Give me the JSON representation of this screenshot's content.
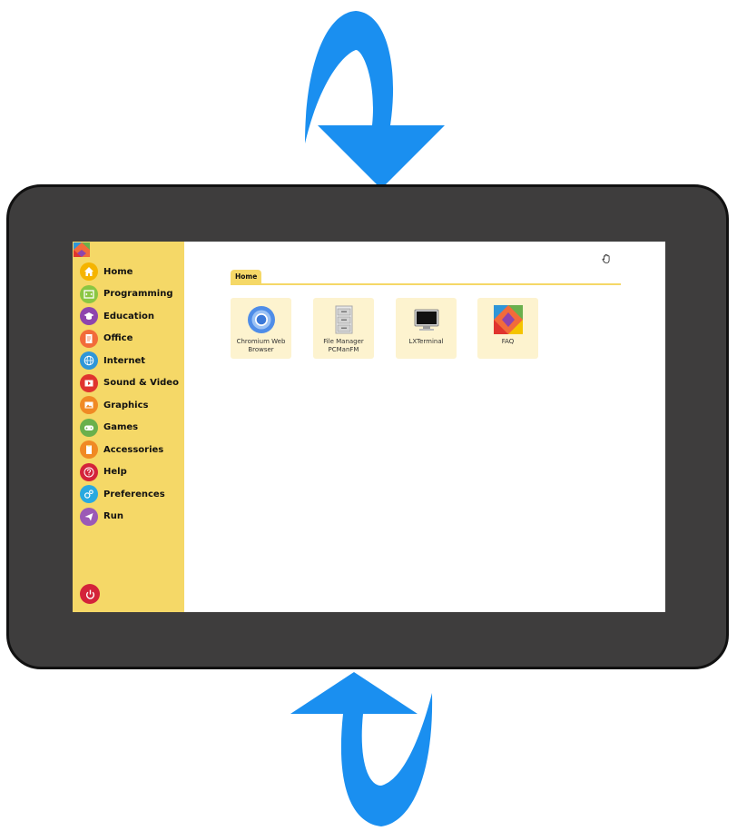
{
  "sidebar": {
    "items": [
      {
        "label": "Home",
        "icon": "home-icon",
        "color": "#f5b400"
      },
      {
        "label": "Programming",
        "icon": "code-icon",
        "color": "#8ac642"
      },
      {
        "label": "Education",
        "icon": "graduation-cap-icon",
        "color": "#8e44ad"
      },
      {
        "label": "Office",
        "icon": "document-icon",
        "color": "#f26b3a"
      },
      {
        "label": "Internet",
        "icon": "globe-icon",
        "color": "#2f96d8"
      },
      {
        "label": "Sound & Video",
        "icon": "play-icon",
        "color": "#e0342e"
      },
      {
        "label": "Graphics",
        "icon": "picture-icon",
        "color": "#f08a24"
      },
      {
        "label": "Games",
        "icon": "gamepad-icon",
        "color": "#6ab04c"
      },
      {
        "label": "Accessories",
        "icon": "clipboard-icon",
        "color": "#f08a24"
      },
      {
        "label": "Help",
        "icon": "question-icon",
        "color": "#d4233a"
      },
      {
        "label": "Preferences",
        "icon": "gears-icon",
        "color": "#29a9e0"
      },
      {
        "label": "Run",
        "icon": "paper-plane-icon",
        "color": "#9b59b6"
      }
    ],
    "power_icon": "power-icon",
    "power_color": "#d4233a"
  },
  "main": {
    "breadcrumb": "Home",
    "apps": [
      {
        "label": "Chromium Web Browser",
        "icon": "chromium-icon"
      },
      {
        "label": "File Manager PCManFM",
        "icon": "file-cabinet-icon"
      },
      {
        "label": "LXTerminal",
        "icon": "monitor-icon"
      },
      {
        "label": "FAQ",
        "icon": "faq-logo-icon"
      }
    ]
  },
  "colors": {
    "sidebar_bg": "#f5d867",
    "tile_bg": "#fdf3cf",
    "arrow": "#1a8ff0",
    "device": "#3e3d3d"
  }
}
